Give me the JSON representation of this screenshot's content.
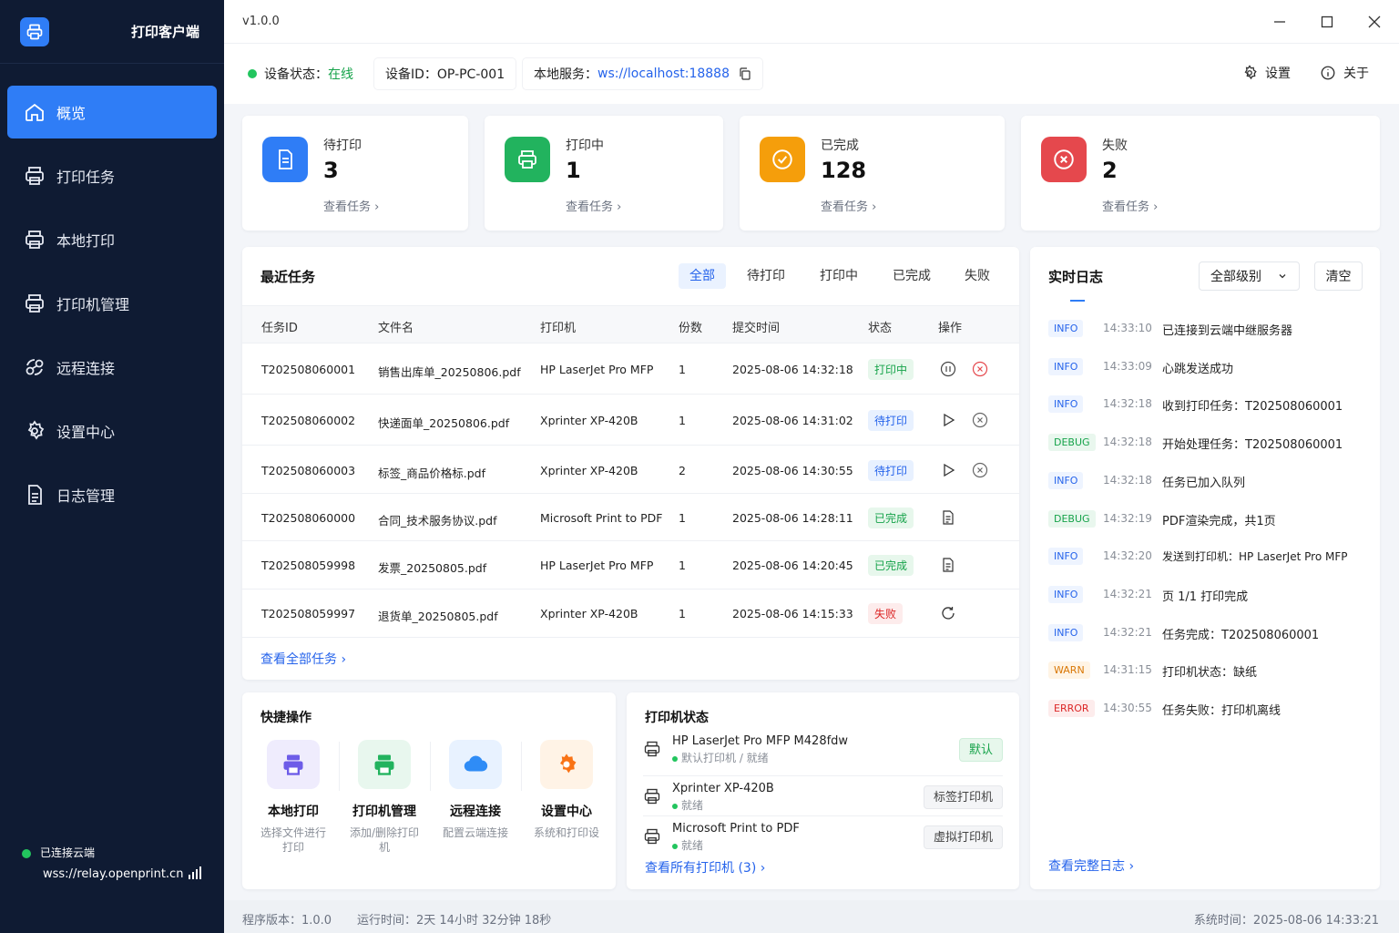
{
  "app": {
    "title": "打印客户端",
    "version": "v1.0.0"
  },
  "sidebar": {
    "items": [
      {
        "label": "概览",
        "icon": "home-icon"
      },
      {
        "label": "打印任务",
        "icon": "printer-icon"
      },
      {
        "label": "本地打印",
        "icon": "printer-icon"
      },
      {
        "label": "打印机管理",
        "icon": "printer-icon"
      },
      {
        "label": "远程连接",
        "icon": "link-icon"
      },
      {
        "label": "设置中心",
        "icon": "gear-icon"
      },
      {
        "label": "日志管理",
        "icon": "document-icon"
      }
    ],
    "cloud": {
      "status": "已连接云端",
      "url": "wss://relay.openprint.cn"
    }
  },
  "status": {
    "device_label": "设备状态：",
    "device_value": "在线",
    "device_id": "设备ID：OP-PC-001",
    "service_label": "本地服务：",
    "service_value": "ws://localhost:18888",
    "settings": "设置",
    "about": "关于"
  },
  "stats": [
    {
      "label": "待打印",
      "value": "3",
      "link": "查看任务",
      "color": "#2f7df6"
    },
    {
      "label": "打印中",
      "value": "1",
      "link": "查看任务",
      "color": "#22b35e"
    },
    {
      "label": "已完成",
      "value": "128",
      "link": "查看任务",
      "color": "#f59e0b"
    },
    {
      "label": "失败",
      "value": "2",
      "link": "查看任务",
      "color": "#e5484d"
    }
  ],
  "recent": {
    "title": "最近任务",
    "tabs": [
      "全部",
      "待打印",
      "打印中",
      "已完成",
      "失败"
    ],
    "columns": [
      "任务ID",
      "文件名",
      "打印机",
      "份数",
      "提交时间",
      "状态",
      "操作"
    ],
    "rows": [
      {
        "id": "T202508060001",
        "file": "销售出库单_20250806.pdf",
        "printer": "HP LaserJet Pro MFP",
        "copies": "1",
        "time": "2025-08-06 14:32:18",
        "status": "打印中"
      },
      {
        "id": "T202508060002",
        "file": "快递面单_20250806.pdf",
        "printer": "Xprinter XP-420B",
        "copies": "1",
        "time": "2025-08-06 14:31:02",
        "status": "待打印"
      },
      {
        "id": "T202508060003",
        "file": "标签_商品价格标.pdf",
        "printer": "Xprinter XP-420B",
        "copies": "2",
        "time": "2025-08-06 14:30:55",
        "status": "待打印"
      },
      {
        "id": "T202508060000",
        "file": "合同_技术服务协议.pdf",
        "printer": "Microsoft Print to PDF",
        "copies": "1",
        "time": "2025-08-06 14:28:11",
        "status": "已完成"
      },
      {
        "id": "T202508059998",
        "file": "发票_20250805.pdf",
        "printer": "HP LaserJet Pro MFP",
        "copies": "1",
        "time": "2025-08-06 14:20:45",
        "status": "已完成"
      },
      {
        "id": "T202508059997",
        "file": "退货单_20250805.pdf",
        "printer": "Xprinter XP-420B",
        "copies": "1",
        "time": "2025-08-06 14:15:33",
        "status": "失败"
      }
    ],
    "view_all": "查看全部任务"
  },
  "quick": {
    "title": "快捷操作",
    "items": [
      {
        "title": "本地打印",
        "sub1": "选择文件进行",
        "sub2": "打印"
      },
      {
        "title": "打印机管理",
        "sub1": "添加/删除打印",
        "sub2": "机"
      },
      {
        "title": "远程连接",
        "sub1": "配置云端连接",
        "sub2": ""
      },
      {
        "title": "设置中心",
        "sub1": "系统和打印设",
        "sub2": ""
      }
    ]
  },
  "printers": {
    "title": "打印机状态",
    "items": [
      {
        "name": "HP LaserJet Pro MFP M428fdw",
        "status": "默认打印机 / 就绪",
        "tag": "默认"
      },
      {
        "name": "Xprinter XP-420B",
        "status": "就绪",
        "tag": "标签打印机"
      },
      {
        "name": "Microsoft Print to PDF",
        "status": "就绪",
        "tag": "虚拟打印机"
      }
    ],
    "view_all": "查看所有打印机 (3)"
  },
  "log": {
    "title": "实时日志",
    "level_select": "全部级别",
    "clear": "清空",
    "entries": [
      {
        "level": "INFO",
        "time": "14:33:10",
        "msg": "已连接到云端中继服务器"
      },
      {
        "level": "INFO",
        "time": "14:33:09",
        "msg": "心跳发送成功"
      },
      {
        "level": "INFO",
        "time": "14:32:18",
        "msg": "收到打印任务：T202508060001"
      },
      {
        "level": "DEBUG",
        "time": "14:32:18",
        "msg": "开始处理任务：T202508060001"
      },
      {
        "level": "INFO",
        "time": "14:32:18",
        "msg": "任务已加入队列"
      },
      {
        "level": "DEBUG",
        "time": "14:32:19",
        "msg": "PDF渲染完成，共1页"
      },
      {
        "level": "INFO",
        "time": "14:32:20",
        "msg": "发送到打印机：HP LaserJet Pro MFP"
      },
      {
        "level": "INFO",
        "time": "14:32:21",
        "msg": "页 1/1 打印完成"
      },
      {
        "level": "INFO",
        "time": "14:32:21",
        "msg": "任务完成：T202508060001"
      },
      {
        "level": "WARN",
        "time": "14:31:15",
        "msg": "打印机状态：缺纸"
      },
      {
        "level": "ERROR",
        "time": "14:30:55",
        "msg": "任务失败：打印机离线"
      }
    ],
    "view_all": "查看完整日志"
  },
  "footer": {
    "version": "程序版本：1.0.0",
    "uptime": "运行时间：2天 14小时 32分钟 18秒",
    "system_time": "系统时间：2025-08-06 14:33:21"
  }
}
